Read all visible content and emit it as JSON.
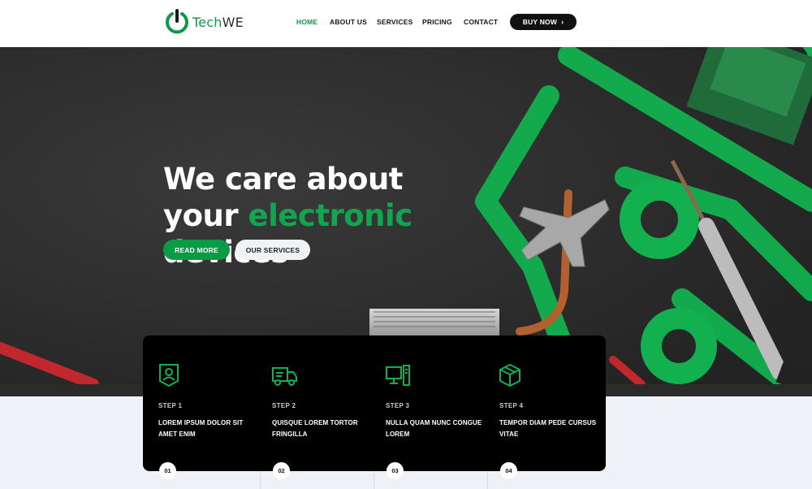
{
  "brand": {
    "tech": "Tech",
    "we": "WE"
  },
  "nav": {
    "items": [
      {
        "label": "HOME",
        "active": true
      },
      {
        "label": "ABOUT US",
        "active": false
      },
      {
        "label": "SERVICES",
        "active": false
      },
      {
        "label": "PRICING",
        "active": false
      },
      {
        "label": "CONTACT",
        "active": false
      }
    ],
    "cta_label": "BUY NOW",
    "cta_icon": "chevron-right-icon"
  },
  "hero": {
    "line1": "We care about",
    "line2_a": "your ",
    "line2_b": "electronic",
    "line3": "devices",
    "read_more": "READ MORE",
    "our_services": "OUR SERVICES"
  },
  "steps": [
    {
      "label": "STEP 1",
      "title": "LOREM IPSUM DOLOR SIT AMET ENIM",
      "number": "01",
      "icon": "user-badge-icon"
    },
    {
      "label": "STEP 2",
      "title": "QUISQUE LOREM TORTOR FRINGILLA",
      "number": "02",
      "icon": "delivery-truck-icon"
    },
    {
      "label": "STEP 3",
      "title": "NULLA QUAM NUNC CONGUE LOREM",
      "number": "03",
      "icon": "computer-icon"
    },
    {
      "label": "STEP 4",
      "title": "TEMPOR DIAM PEDE CURSUS VITAE",
      "number": "04",
      "icon": "package-box-icon"
    }
  ],
  "colors": {
    "accent": "#0a9b47",
    "dark": "#000000",
    "hero_bg": "#2f2f2f",
    "section_bg": "#eef1f8"
  }
}
